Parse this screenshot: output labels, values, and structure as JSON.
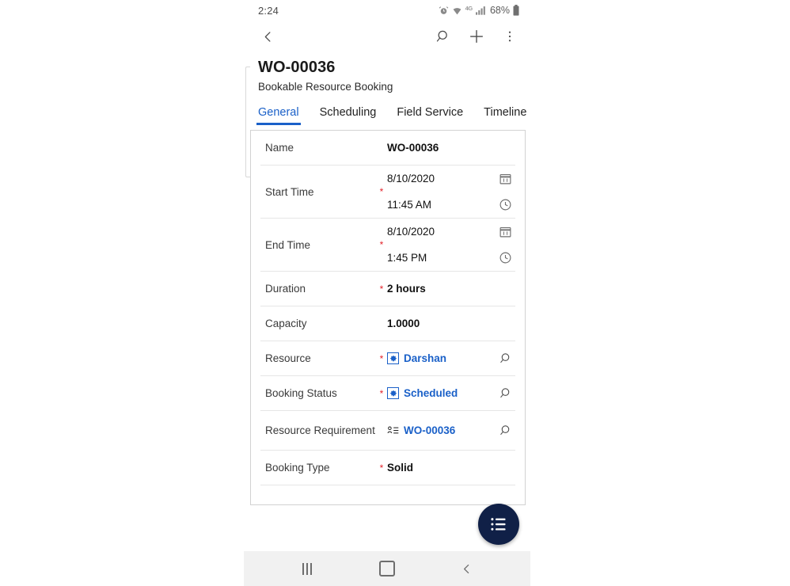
{
  "status_bar": {
    "clock": "2:24",
    "battery_percent": "68%",
    "network_label": "4G",
    "icons": [
      "alarm-icon",
      "wifi-icon",
      "network-4g-icon",
      "signal-bars-icon",
      "battery-icon"
    ]
  },
  "app_bar": {
    "back_icon": "back-chevron-icon",
    "search_icon": "search-icon",
    "add_icon": "plus-icon",
    "overflow_icon": "more-vertical-icon"
  },
  "record": {
    "title": "WO-00036",
    "subtitle": "Bookable Resource Booking"
  },
  "tabs": [
    {
      "label": "General",
      "active": true
    },
    {
      "label": "Scheduling",
      "active": false
    },
    {
      "label": "Field Service",
      "active": false
    },
    {
      "label": "Timeline",
      "active": false
    }
  ],
  "form": {
    "rows": [
      {
        "label": "Name",
        "required": false,
        "value": "WO-00036",
        "type": "text"
      },
      {
        "label": "Start Time",
        "required": true,
        "date": "8/10/2020",
        "time": "11:45 AM",
        "type": "datetime",
        "date_icon": "calendar-icon",
        "time_icon": "clock-icon"
      },
      {
        "label": "End Time",
        "required": true,
        "date": "8/10/2020",
        "time": "1:45 PM",
        "type": "datetime",
        "date_icon": "calendar-icon",
        "time_icon": "clock-icon"
      },
      {
        "label": "Duration",
        "required": true,
        "value": "2 hours",
        "type": "text"
      },
      {
        "label": "Capacity",
        "required": false,
        "value": "1.0000",
        "type": "text"
      },
      {
        "label": "Resource",
        "required": true,
        "value": "Darshan",
        "type": "lookup",
        "entity_icon": "resource-entity-icon",
        "trail_icon": "lookup-search-icon"
      },
      {
        "label": "Booking Status",
        "required": true,
        "value": "Scheduled",
        "type": "lookup",
        "entity_icon": "booking-status-entity-icon",
        "trail_icon": "lookup-search-icon"
      },
      {
        "label": "Resource Requirement",
        "required": false,
        "value": "WO-00036",
        "type": "lookup-requirement",
        "entity_icon": "requirement-entity-icon",
        "trail_icon": "lookup-search-icon"
      },
      {
        "label": "Booking Type",
        "required": true,
        "value": "Solid",
        "type": "text"
      }
    ]
  },
  "fab": {
    "icon": "list-menu-icon"
  },
  "nav_bar": {
    "recents_icon": "recents-icon",
    "home_icon": "home-icon",
    "back_icon": "back-chevron-icon"
  },
  "colors": {
    "accent_blue": "#1a60c8",
    "required_red": "#e3232b",
    "fab_navy": "#102047",
    "nav_bg": "#f1f1f1",
    "card_border": "#d2d2d2"
  }
}
